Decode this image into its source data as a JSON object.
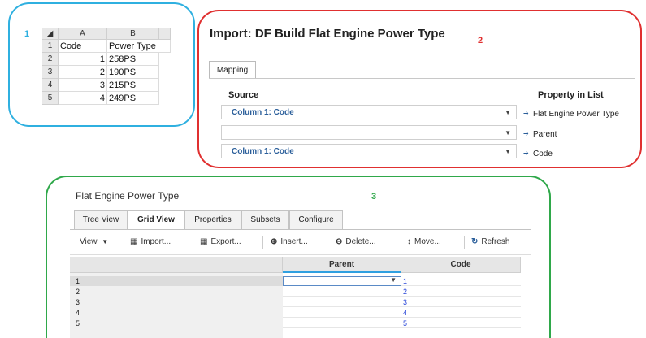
{
  "callouts": {
    "n1": "1",
    "n2": "2",
    "n3": "3"
  },
  "sheet": {
    "columns": [
      "A",
      "B"
    ],
    "row_numbers": [
      "1",
      "2",
      "3",
      "4",
      "5"
    ],
    "rows": [
      {
        "a": "Code",
        "b": "Power Type"
      },
      {
        "a": "1",
        "b": "258PS"
      },
      {
        "a": "2",
        "b": "190PS"
      },
      {
        "a": "3",
        "b": "215PS"
      },
      {
        "a": "4",
        "b": "249PS"
      }
    ]
  },
  "import": {
    "title": "Import: DF Build Flat Engine Power Type",
    "tab": "Mapping",
    "source_header": "Source",
    "property_header": "Property in List",
    "mappings": [
      {
        "source": "Column 1: Code",
        "property": "Flat Engine Power Type"
      },
      {
        "source": "",
        "property": "Parent"
      },
      {
        "source": "Column 1: Code",
        "property": "Code"
      }
    ]
  },
  "gridview": {
    "title": "Flat Engine Power Type",
    "tabs": [
      "Tree View",
      "Grid View",
      "Properties",
      "Subsets",
      "Configure"
    ],
    "active_tab": "Grid View",
    "toolbar": {
      "view": "View",
      "import": "Import...",
      "export": "Export...",
      "insert": "Insert...",
      "delete": "Delete...",
      "move": "Move...",
      "refresh": "Refresh"
    },
    "columns": [
      "Parent",
      "Code"
    ],
    "rows": [
      {
        "num": "1",
        "parent": "",
        "code": "1"
      },
      {
        "num": "2",
        "parent": "",
        "code": "2"
      },
      {
        "num": "3",
        "parent": "",
        "code": "3"
      },
      {
        "num": "4",
        "parent": "",
        "code": "4"
      },
      {
        "num": "5",
        "parent": "",
        "code": "5"
      }
    ]
  },
  "colors": {
    "blue_frame": "#2fb0e0",
    "red_frame": "#e03030",
    "green_frame": "#2fa84a",
    "link_blue": "#2a47d8"
  }
}
